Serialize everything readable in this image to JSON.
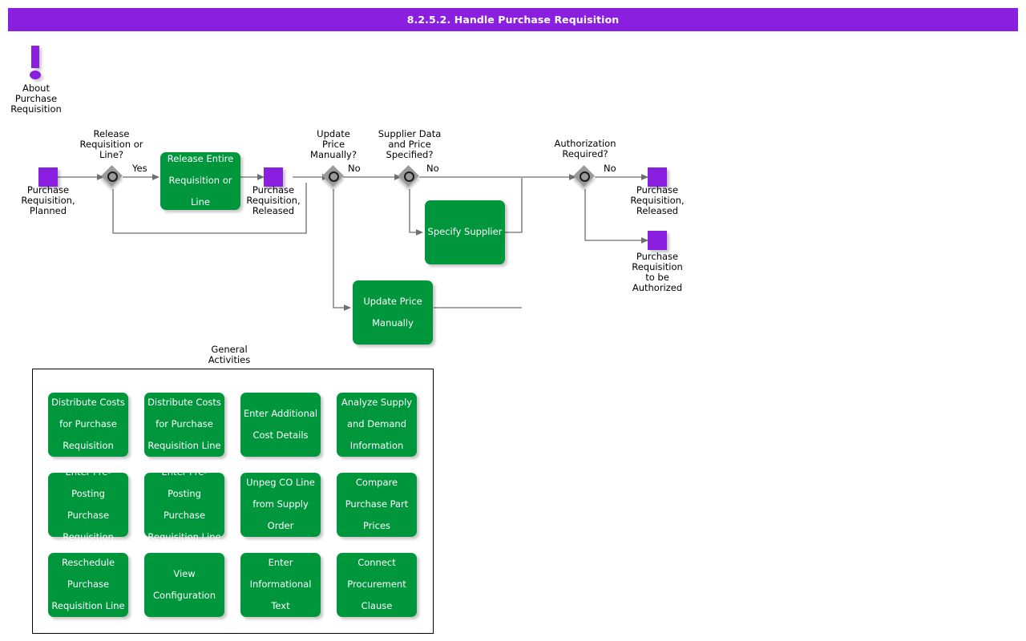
{
  "window": {
    "title": "8.2.5.2. Handle Purchase Requisition"
  },
  "about": {
    "icon": "exclamation-icon",
    "label": "About\nPurchase\nRequisition",
    "line1": "About",
    "line2": "Purchase",
    "line3": "Requisition"
  },
  "colors": {
    "title_bar": "#8A1FE0",
    "state_square": "#8A1FE0",
    "activity_box": "#00963C",
    "decision_diamond": "#9A9A9A",
    "connector": "#6E6E6E",
    "text_on_green": "#FFFFFF",
    "text_default": "#000000"
  },
  "flow": {
    "states": [
      {
        "id": "pr-planned",
        "label": "Purchase\nRequisition,\nPlanned",
        "lines": [
          "Purchase",
          "Requisition,",
          "Planned"
        ]
      },
      {
        "id": "pr-released-1",
        "label": "Purchase\nRequisition,\nReleased",
        "lines": [
          "Purchase",
          "Requisition,",
          "Released"
        ]
      },
      {
        "id": "pr-released-2",
        "label": "Purchase\nRequisition,\nReleased",
        "lines": [
          "Purchase",
          "Requisition,",
          "Released"
        ]
      },
      {
        "id": "pr-to-be-authorized",
        "label": "Purchase\nRequisition\nto be\nAuthorized",
        "lines": [
          "Purchase",
          "Requisition",
          "to be",
          "Authorized"
        ]
      }
    ],
    "decisions": [
      {
        "id": "release-req-or-line",
        "label": "Release\nRequisition or\nLine?",
        "lines": [
          "Release",
          "Requisition or",
          "Line?"
        ],
        "edge_label": "Yes"
      },
      {
        "id": "update-price-manually",
        "label": "Update\nPrice\nManually?",
        "lines": [
          "Update",
          "Price",
          "Manually?"
        ],
        "edge_label": "No"
      },
      {
        "id": "supplier-data-price-specified",
        "label": "Supplier Data\nand Price\nSpecified?",
        "lines": [
          "Supplier Data",
          "and Price",
          "Specified?"
        ],
        "edge_label": "No"
      },
      {
        "id": "authorization-required",
        "label": "Authorization\nRequired?",
        "lines": [
          "Authorization",
          "Required?"
        ],
        "edge_label": "No"
      }
    ],
    "activities": [
      {
        "id": "release-entire-requisition-or-line",
        "label": "Release Entire\nRequisition or\nLine",
        "lines": [
          "Release Entire",
          "Requisition or",
          "Line"
        ]
      },
      {
        "id": "specify-supplier",
        "label": "Specify Supplier",
        "lines": [
          "Specify Supplier"
        ]
      },
      {
        "id": "update-price-manually",
        "label": "Update Price\nManually",
        "lines": [
          "Update Price",
          "Manually"
        ]
      }
    ]
  },
  "general_activities": {
    "title_lines": [
      "General",
      "Activities"
    ],
    "items": [
      {
        "id": "distribute-costs-for-purchase-requisition",
        "lines": [
          "Distribute Costs",
          "for Purchase",
          "Requisition"
        ]
      },
      {
        "id": "distribute-costs-for-purchase-requisition-line",
        "lines": [
          "Distribute Costs",
          "for Purchase",
          "Requisition Line"
        ]
      },
      {
        "id": "enter-additional-cost-details",
        "lines": [
          "Enter Additional",
          "Cost Details"
        ]
      },
      {
        "id": "analyze-supply-and-demand-information",
        "lines": [
          "Analyze Supply",
          "and Demand",
          "Information"
        ]
      },
      {
        "id": "enter-pre-posting-purchase-requisition",
        "lines": [
          "Enter Pre-",
          "Posting",
          "Purchase",
          "Requisition"
        ]
      },
      {
        "id": "enter-pre-posting-purchase-requisition-line",
        "lines": [
          "Enter Pre-",
          "Posting",
          "Purchase",
          "Requisition Line"
        ]
      },
      {
        "id": "unpeg-co-line-from-supply-order",
        "lines": [
          "Unpeg CO Line",
          "from Supply",
          "Order"
        ]
      },
      {
        "id": "compare-purchase-part-prices",
        "lines": [
          "Compare",
          "Purchase Part",
          "Prices"
        ]
      },
      {
        "id": "reschedule-purchase-requisition-line",
        "lines": [
          "Reschedule",
          "Purchase",
          "Requisition Line"
        ]
      },
      {
        "id": "view-configuration",
        "lines": [
          "View",
          "Configuration"
        ]
      },
      {
        "id": "enter-informational-text",
        "lines": [
          "Enter",
          "Informational",
          "Text"
        ]
      },
      {
        "id": "connect-procurement-clause",
        "lines": [
          "Connect",
          "Procurement",
          "Clause"
        ]
      }
    ]
  }
}
